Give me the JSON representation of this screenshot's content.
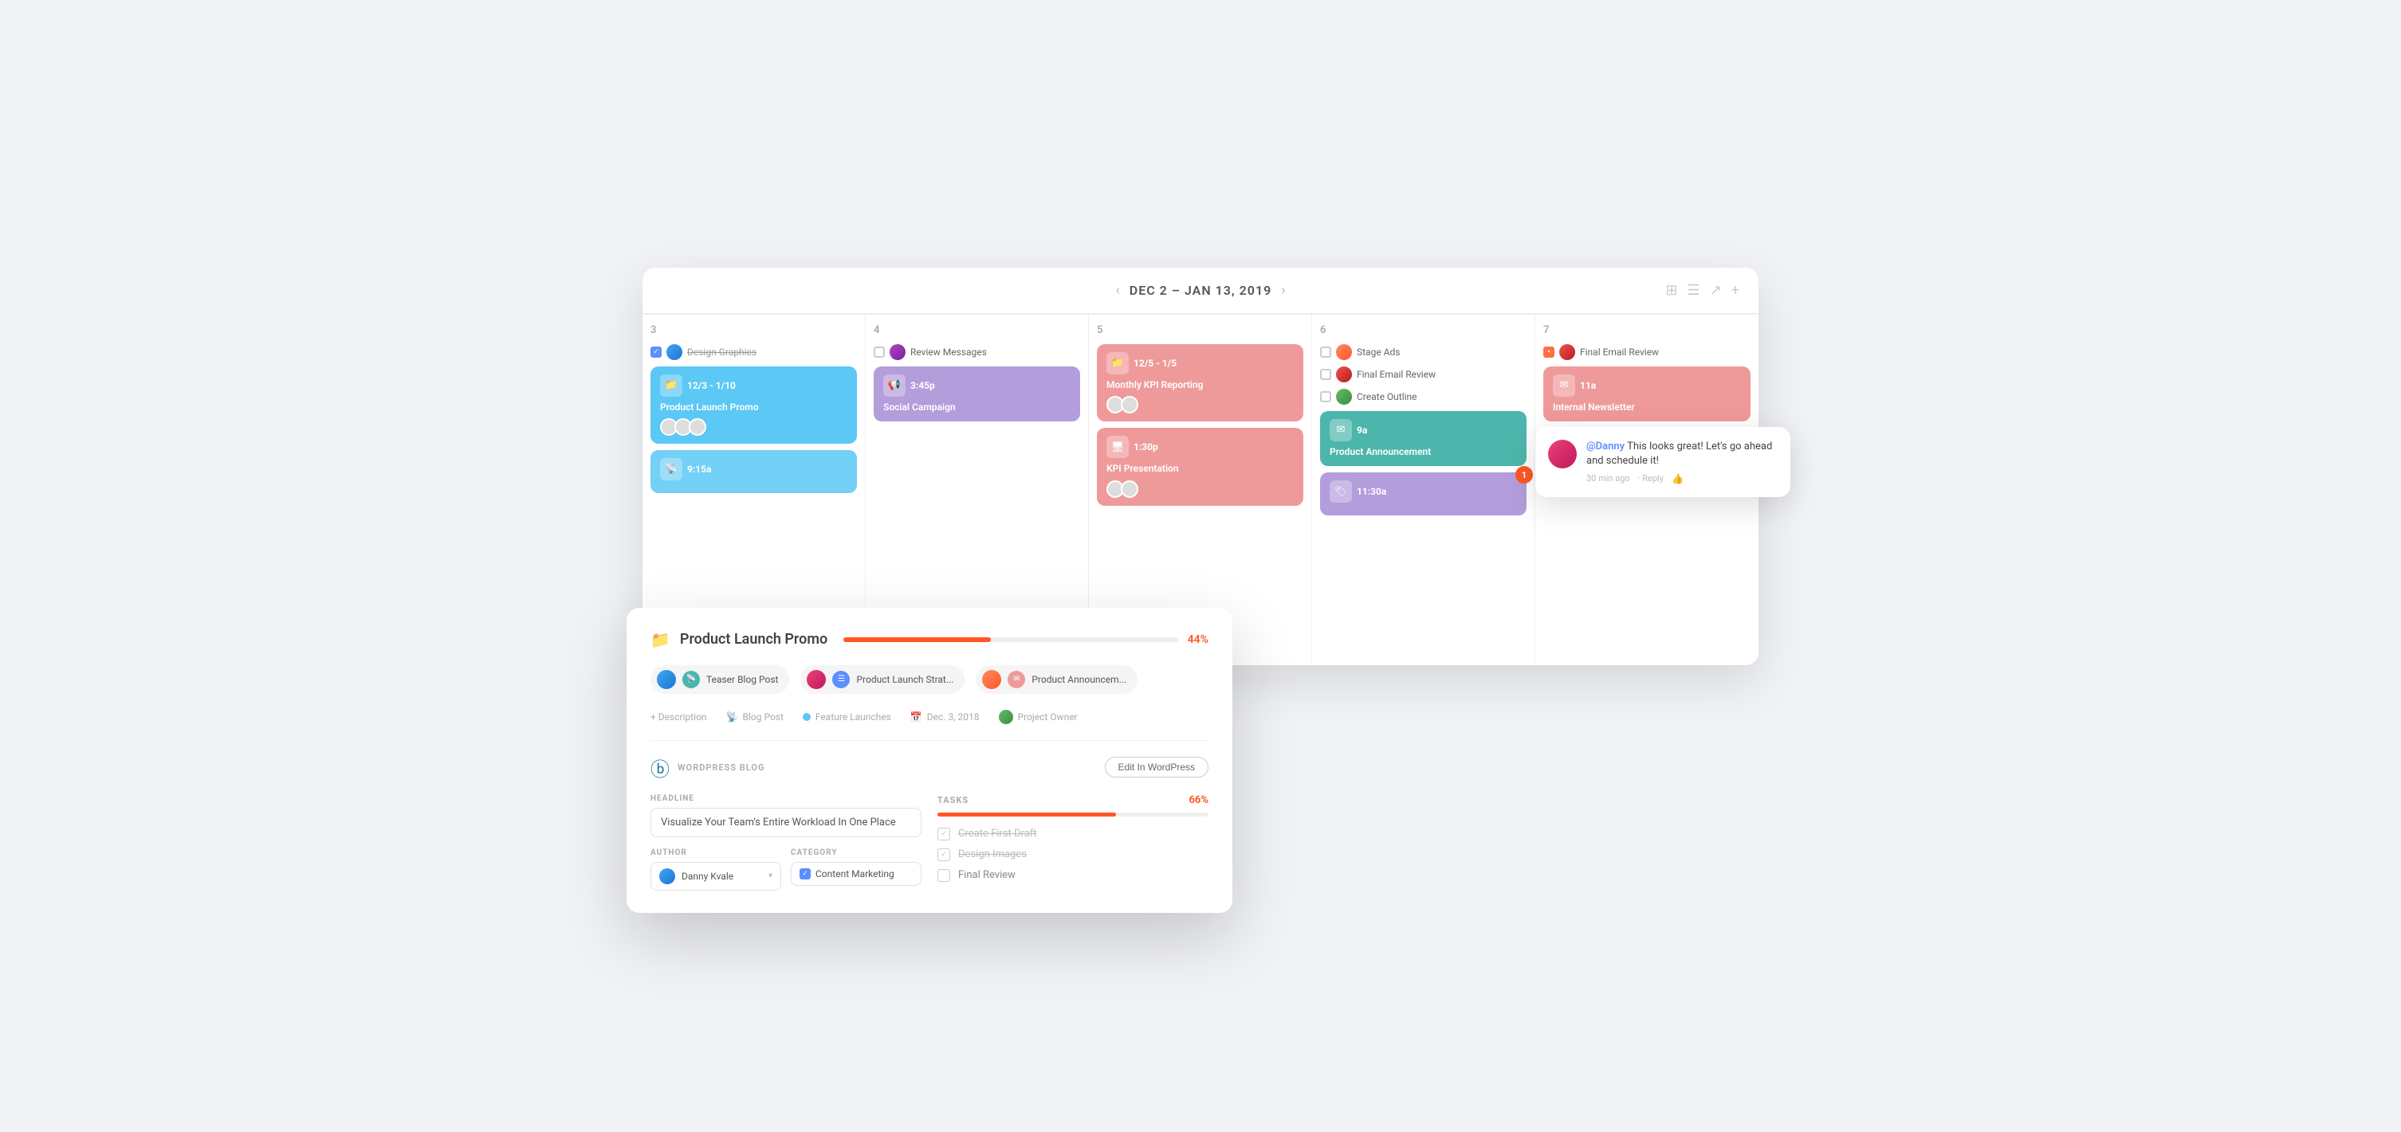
{
  "calendar": {
    "dateRange": "DEC 2 – JAN 13, 2019",
    "columns": [
      {
        "number": "3"
      },
      {
        "number": "4"
      },
      {
        "number": "5"
      },
      {
        "number": "6"
      },
      {
        "number": "7"
      }
    ]
  },
  "col3": {
    "checkboxTask": {
      "checked": true,
      "label": "Design Graphics"
    },
    "event1": {
      "timeRange": "12/3 - 1/10",
      "title": "Product Launch Promo",
      "color": "blue"
    },
    "event2": {
      "time": "9:15a",
      "color": "blue"
    }
  },
  "col4": {
    "checkboxTask": {
      "checked": false,
      "label": "Review Messages"
    },
    "event1": {
      "time": "3:45p",
      "title": "Social Campaign",
      "color": "purple"
    }
  },
  "col5": {
    "event1": {
      "timeRange": "12/5 - 1/5",
      "title": "Monthly KPI Reporting",
      "color": "salmon"
    },
    "event2": {
      "time": "1:30p",
      "title": "KPI Presentation",
      "color": "salmon"
    }
  },
  "col6": {
    "tasks": [
      {
        "label": "Stage Ads"
      },
      {
        "label": "Final Email Review"
      },
      {
        "label": "Create Outline"
      }
    ],
    "event1": {
      "time": "9a",
      "title": "Product Announcement",
      "color": "teal"
    },
    "event2": {
      "time": "11:30a",
      "color": "purple"
    }
  },
  "col7": {
    "task": {
      "label": "Final Email Review"
    },
    "event1": {
      "time": "11a",
      "title": "Internal Newsletter",
      "color": "salmon"
    }
  },
  "detailPanel": {
    "folderIcon": "📁",
    "title": "Product Launch Promo",
    "progressPercent": 44,
    "progressLabel": "44%",
    "subtasks": [
      {
        "label": "Teaser Blog Post",
        "icon": "📡"
      },
      {
        "label": "Product Launch Strat...",
        "icon": "☰"
      },
      {
        "label": "Product Announcem...",
        "icon": "✉"
      }
    ],
    "meta": {
      "addDescription": "+ Description",
      "type": "Blog Post",
      "category": "Feature Launches",
      "date": "Dec. 3, 2018",
      "owner": "Project Owner"
    },
    "wordpress": {
      "logoLabel": "WORDPRESS BLOG",
      "editBtnLabel": "Edit In WordPress"
    },
    "headline": {
      "label": "HEADLINE",
      "value": "Visualize Your Team's Entire Workload In One Place"
    },
    "author": {
      "label": "AUTHOR",
      "name": "Danny Kvale"
    },
    "category": {
      "label": "CATEGORY",
      "value": "Content Marketing"
    },
    "tasks": {
      "label": "TASKS",
      "percent": "66%",
      "percentNum": 66,
      "items": [
        {
          "label": "Create First Draft",
          "done": true
        },
        {
          "label": "Design Images",
          "done": true
        },
        {
          "label": "Final Review",
          "done": false
        }
      ]
    }
  },
  "comment": {
    "mention": "@Danny",
    "text": "This looks great! Let's go ahead and schedule it!",
    "time": "30 min ago",
    "replyLabel": "Reply",
    "notifCount": "1"
  }
}
